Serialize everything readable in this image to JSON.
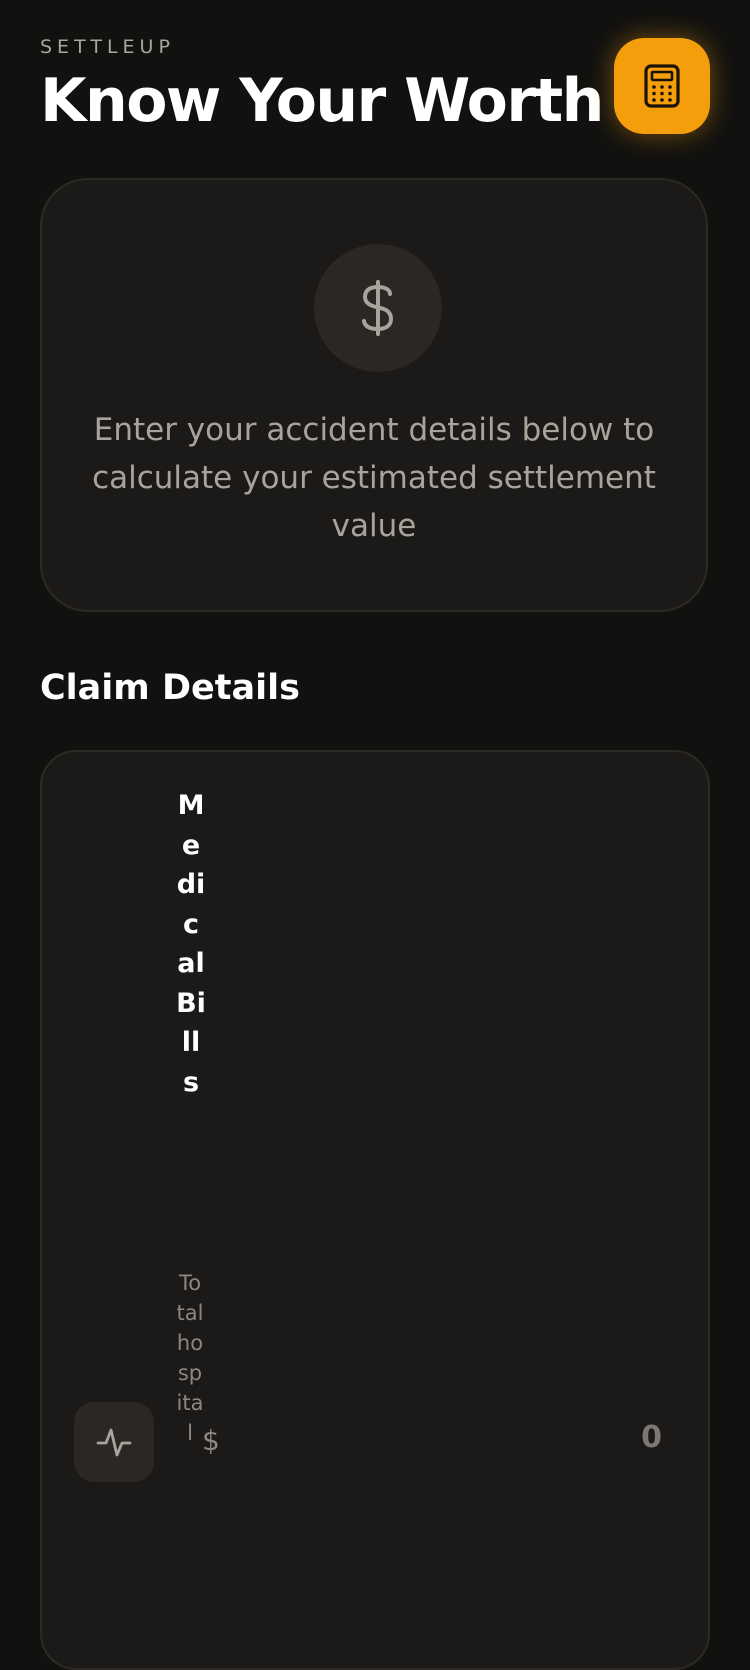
{
  "header": {
    "brand": "SETTLEUP",
    "title": "Know Your Worth",
    "calculator_button_icon": "calculator-icon",
    "accent_color": "#f59e0b"
  },
  "hero": {
    "icon": "dollar-icon",
    "message": "Enter your accident details below to calculate your estimated settlement value"
  },
  "claim_details": {
    "section_title": "Claim Details",
    "fields": [
      {
        "icon": "activity-icon",
        "label": "Medical Bills",
        "sublabel": "Total hospital",
        "currency": "$",
        "value": "",
        "placeholder": "0"
      }
    ]
  }
}
